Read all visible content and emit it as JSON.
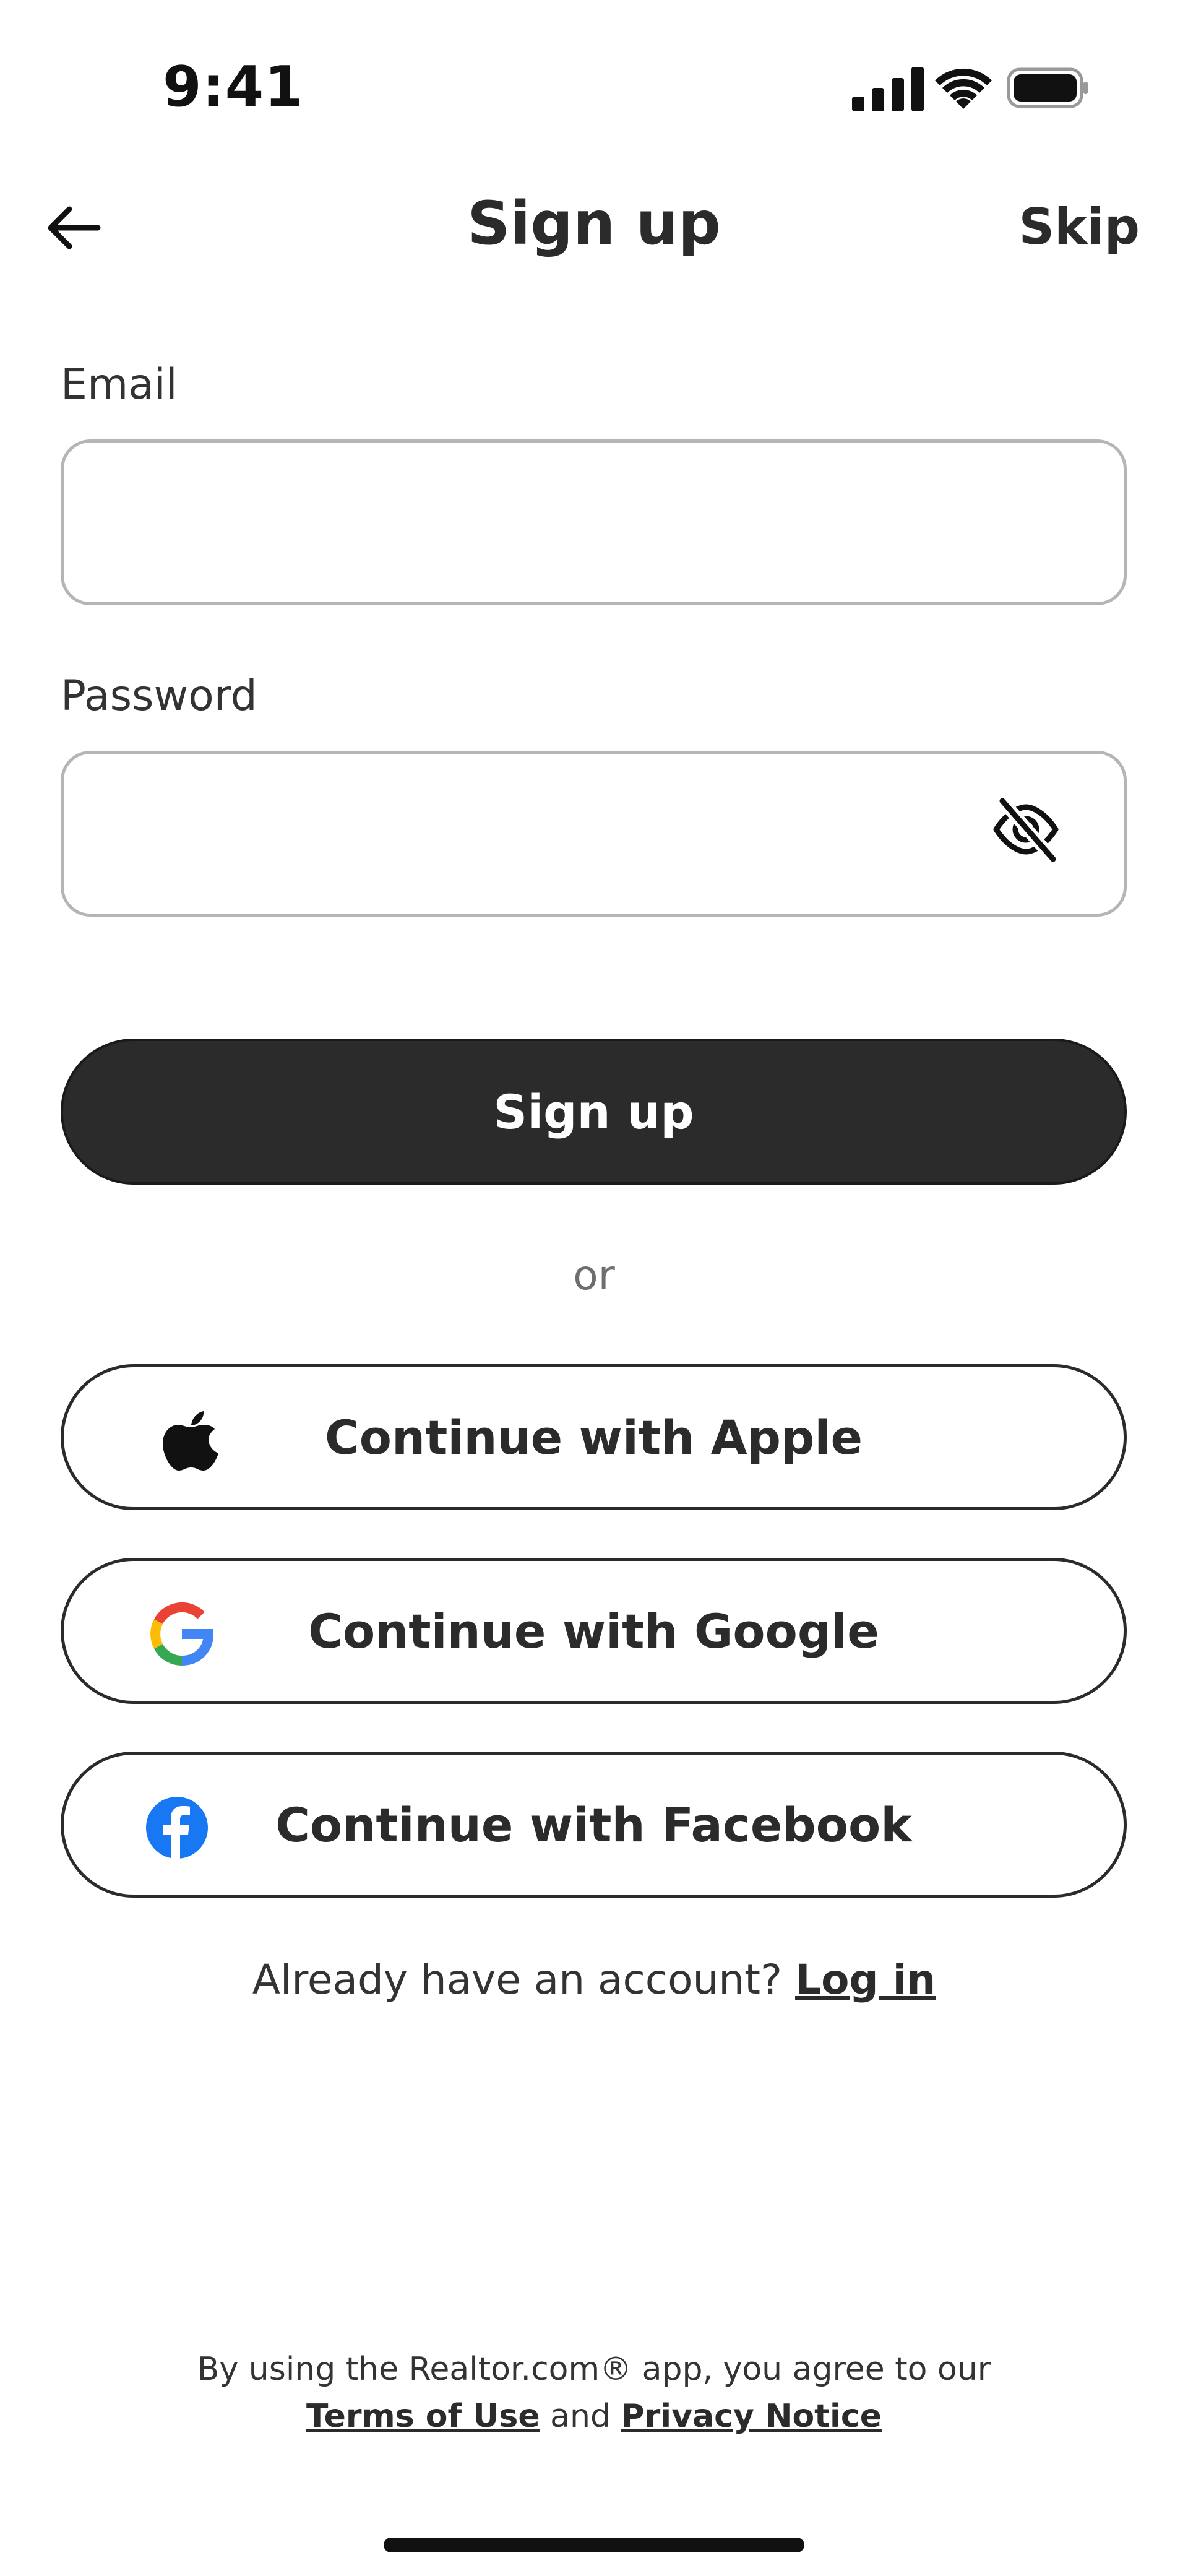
{
  "status_bar": {
    "time": "9:41"
  },
  "header": {
    "title": "Sign up",
    "skip_label": "Skip"
  },
  "form": {
    "email_label": "Email",
    "email_value": "",
    "password_label": "Password",
    "password_value": ""
  },
  "primary_button": {
    "label": "Sign up"
  },
  "divider_text": "or",
  "social": {
    "apple_label": "Continue with Apple",
    "google_label": "Continue with Google",
    "facebook_label": "Continue with Facebook"
  },
  "login_prompt": {
    "text": "Already have an account?",
    "link": "Log in"
  },
  "legal": {
    "line1": "By using the Realtor.com® app, you agree to our",
    "terms": "Terms of Use",
    "and": "and",
    "privacy": "Privacy Notice"
  },
  "icons": {
    "back": "arrow-left-icon",
    "eye": "eye-slash-icon",
    "apple": "apple-logo-icon",
    "google": "google-logo-icon",
    "facebook": "facebook-logo-icon"
  },
  "colors": {
    "primary": "#2b2b2b",
    "input_border": "#b5b5b5",
    "facebook_blue": "#1877F2"
  }
}
